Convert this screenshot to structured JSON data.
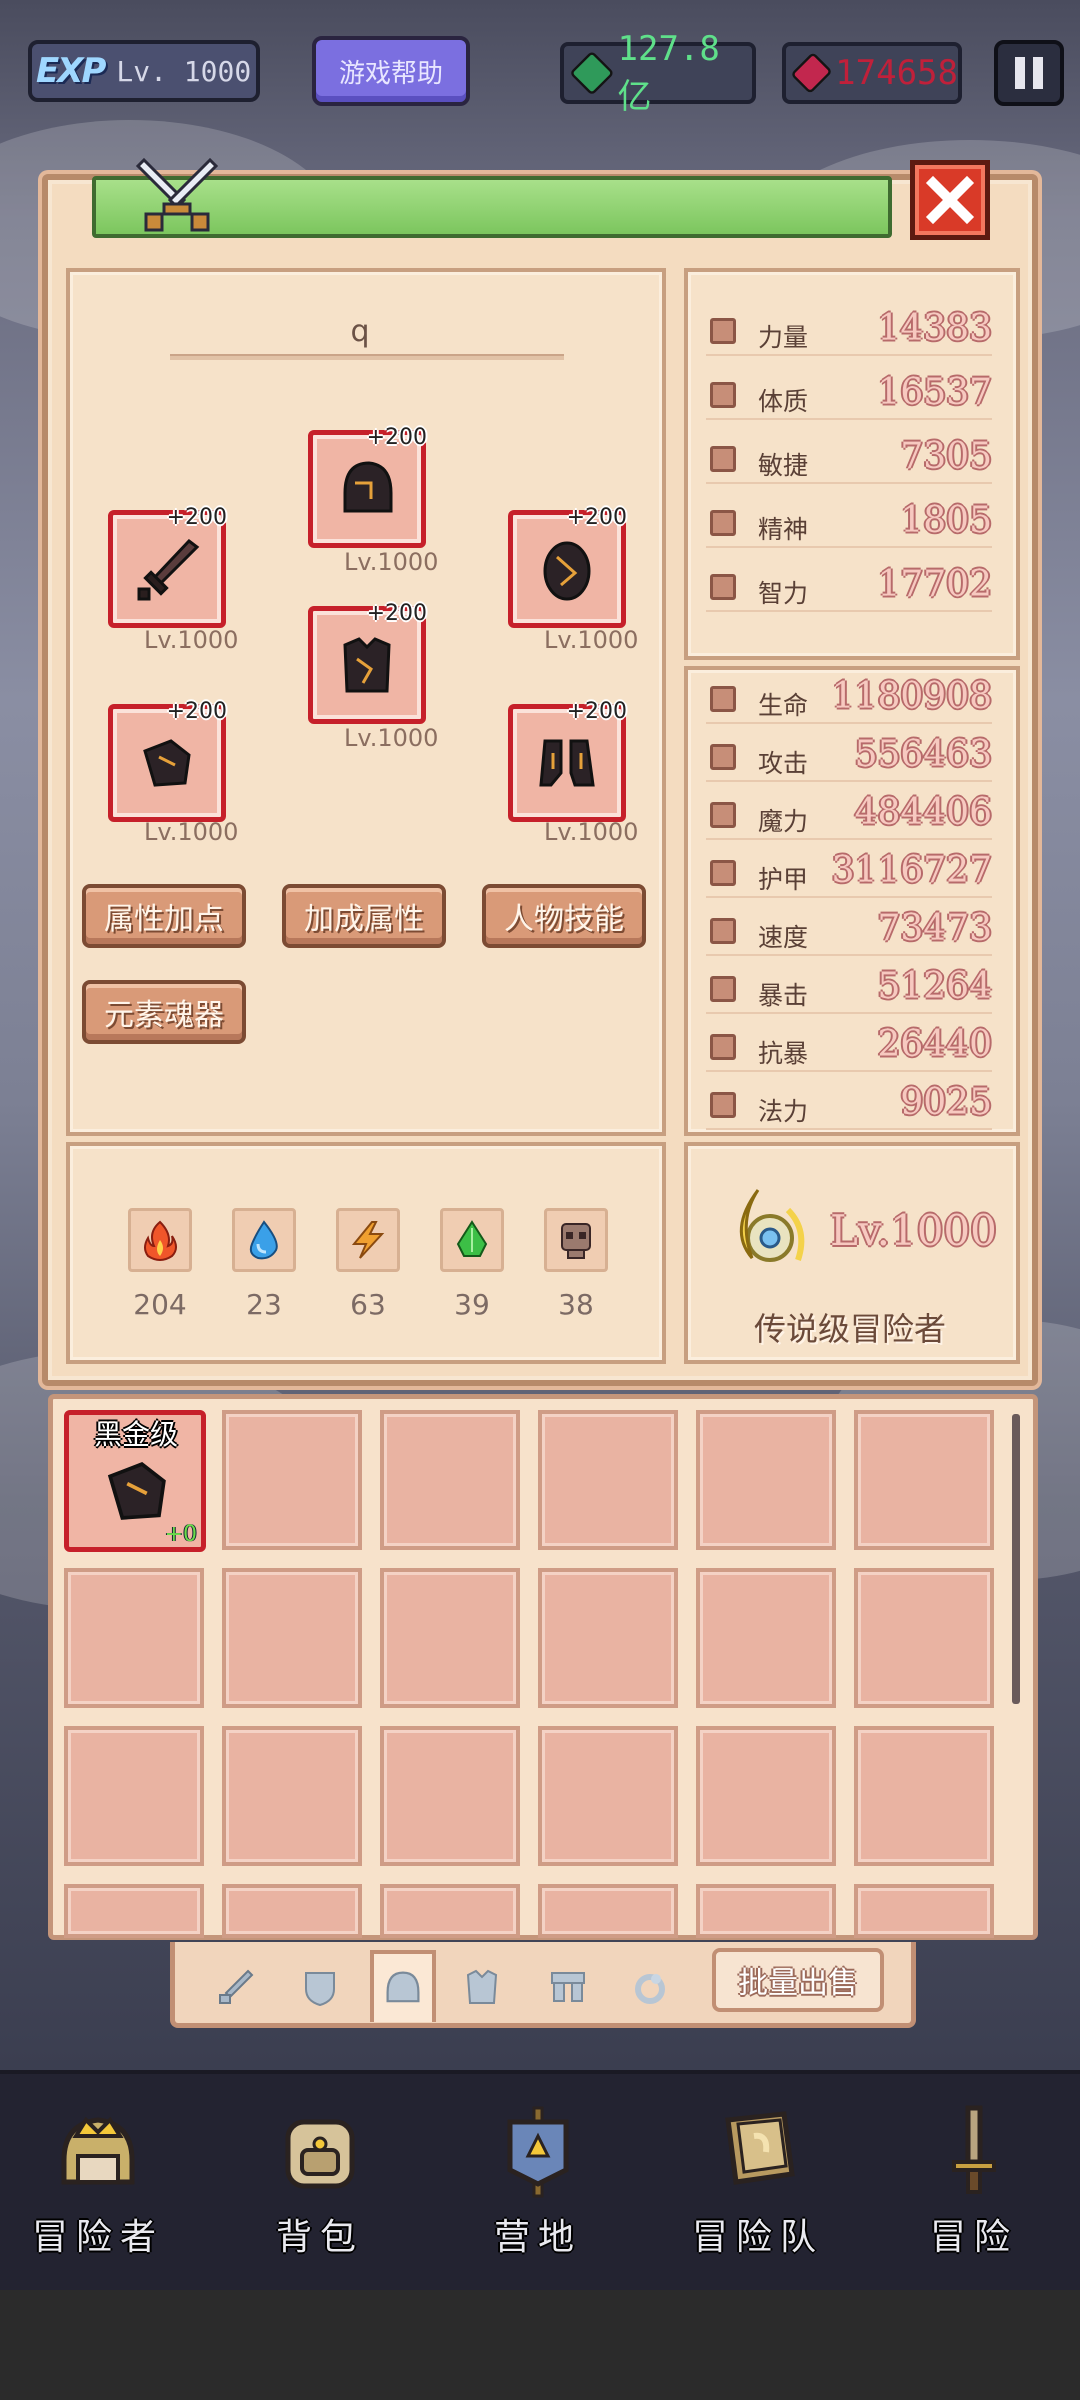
{
  "hud": {
    "exp_label": "EXP",
    "level": "Lv. 1000",
    "help_button": "游戏帮助",
    "green_currency": "127.8亿",
    "red_currency": "174658"
  },
  "hero": {
    "name": "q",
    "equipment": [
      {
        "slot": "weapon",
        "plus": "+200",
        "level": "Lv.1000"
      },
      {
        "slot": "helmet",
        "plus": "+200",
        "level": "Lv.1000"
      },
      {
        "slot": "shield",
        "plus": "+200",
        "level": "Lv.1000"
      },
      {
        "slot": "armor",
        "plus": "+200",
        "level": "Lv.1000"
      },
      {
        "slot": "gloves",
        "plus": "+200",
        "level": "Lv.1000"
      },
      {
        "slot": "boots",
        "plus": "+200",
        "level": "Lv.1000"
      }
    ],
    "buttons": {
      "attribute_points": "属性加点",
      "bonus_attributes": "加成属性",
      "character_skills": "人物技能",
      "element_soul": "元素魂器"
    },
    "elements": [
      {
        "name": "fire",
        "count": "204",
        "color": "#f0562a"
      },
      {
        "name": "water",
        "count": "23",
        "color": "#3aa0e8"
      },
      {
        "name": "thunder",
        "count": "63",
        "color": "#f0a030"
      },
      {
        "name": "nature",
        "count": "39",
        "color": "#3cbf46"
      },
      {
        "name": "dark",
        "count": "38",
        "color": "#6b4a4a"
      }
    ]
  },
  "base_stats": [
    {
      "label": "力量",
      "value": "14383"
    },
    {
      "label": "体质",
      "value": "16537"
    },
    {
      "label": "敏捷",
      "value": "7305"
    },
    {
      "label": "精神",
      "value": "1805"
    },
    {
      "label": "智力",
      "value": "17702"
    }
  ],
  "combat_stats": [
    {
      "label": "生命",
      "value": "1180908"
    },
    {
      "label": "攻击",
      "value": "556463"
    },
    {
      "label": "魔力",
      "value": "484406"
    },
    {
      "label": "护甲",
      "value": "3116727"
    },
    {
      "label": "速度",
      "value": "73473"
    },
    {
      "label": "暴击",
      "value": "51264"
    },
    {
      "label": "抗暴",
      "value": "26440"
    },
    {
      "label": "法力",
      "value": "9025"
    }
  ],
  "rank": {
    "level": "Lv.1000",
    "title": "传说级冒险者"
  },
  "inventory": {
    "item": {
      "grade": "黑金级",
      "enhance": "+0"
    },
    "tabs": [
      "sword-icon",
      "shield-icon",
      "helmet-icon",
      "armor-icon",
      "boots-icon",
      "ring-icon"
    ],
    "active_tab": "helmet-icon",
    "bulk_sell": "批量出售"
  },
  "nav": [
    {
      "label": "冒险者",
      "icon": "crown-helmet-icon"
    },
    {
      "label": "背包",
      "icon": "backpack-icon"
    },
    {
      "label": "营地",
      "icon": "banner-icon"
    },
    {
      "label": "冒险队",
      "icon": "book-icon"
    },
    {
      "label": "冒险",
      "icon": "sword-icon"
    }
  ],
  "colors": {
    "panel_bg": "#f4dcc0",
    "slot_border": "#c6202a",
    "stat_value": "#f7c9c0",
    "title_bar": "#8dd26e"
  }
}
